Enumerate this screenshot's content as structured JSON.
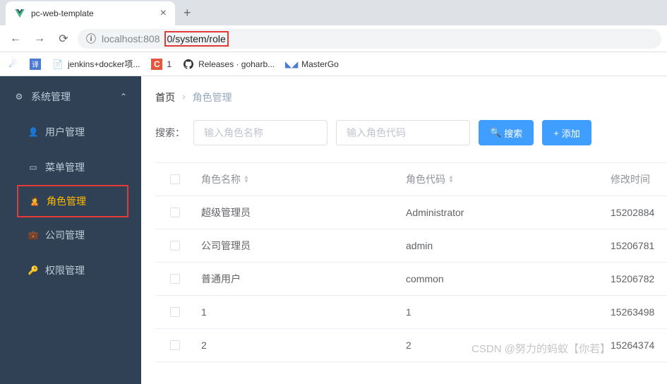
{
  "browser": {
    "tab_title": "pc-web-template",
    "url_prefix": "localhost:808",
    "url_path": "0/system/role"
  },
  "bookmarks": [
    {
      "icon": "paw",
      "label": ""
    },
    {
      "icon": "translate",
      "label": ""
    },
    {
      "icon": "page",
      "label": "jenkins+docker项..."
    },
    {
      "icon": "c1",
      "label": "1"
    },
    {
      "icon": "github",
      "label": "Releases · goharb..."
    },
    {
      "icon": "mg",
      "label": "MasterGo"
    }
  ],
  "sidebar": {
    "group_label": "系统管理",
    "items": [
      {
        "icon": "user",
        "label": "用户管理"
      },
      {
        "icon": "menu",
        "label": "菜单管理"
      },
      {
        "icon": "role",
        "label": "角色管理"
      },
      {
        "icon": "company",
        "label": "公司管理"
      },
      {
        "icon": "perm",
        "label": "权限管理"
      }
    ]
  },
  "breadcrumb": {
    "home": "首页",
    "current": "角色管理"
  },
  "filter": {
    "label": "搜索：",
    "name_placeholder": "输入角色名称",
    "code_placeholder": "输入角色代码",
    "search_btn": "搜索",
    "add_btn": "添加"
  },
  "table": {
    "columns": {
      "name": "角色名称",
      "code": "角色代码",
      "time": "修改时间"
    },
    "rows": [
      {
        "name": "超级管理员",
        "code": "Administrator",
        "time": "15202884"
      },
      {
        "name": "公司管理员",
        "code": "admin",
        "time": "15206781"
      },
      {
        "name": "普通用户",
        "code": "common",
        "time": "15206782"
      },
      {
        "name": "1",
        "code": "1",
        "time": "15263498"
      },
      {
        "name": "2",
        "code": "2",
        "time": "15264374"
      }
    ]
  },
  "watermark": "CSDN @努力的蚂蚁【你若】"
}
